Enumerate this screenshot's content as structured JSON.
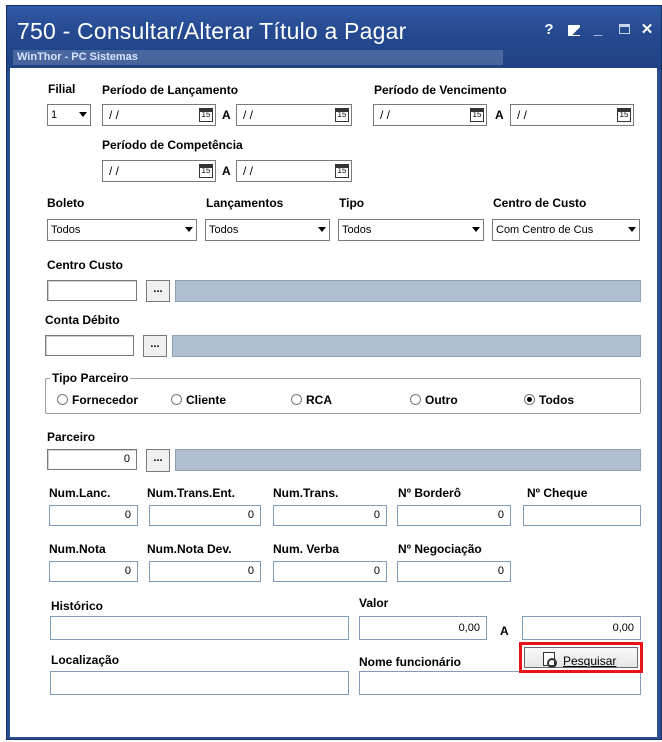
{
  "window": {
    "title": "750 - Consultar/Alterar Título a Pagar",
    "subtitle": "WinThor - PC Sistemas",
    "help": "?",
    "minimize": "_",
    "close": "✕"
  },
  "filial": {
    "label": "Filial",
    "value": "1"
  },
  "periodo_lancamento": {
    "label": "Período de Lançamento",
    "start": "/ /",
    "sep": "A",
    "end": "/ /",
    "cal": "15"
  },
  "periodo_vencimento": {
    "label": "Período de Vencimento",
    "start": "/ /",
    "sep": "A",
    "end": "/ /",
    "cal": "15"
  },
  "periodo_competencia": {
    "label": "Período de Competência",
    "start": "/ /",
    "sep": "A",
    "end": "/ /",
    "cal": "15"
  },
  "boleto": {
    "label": "Boleto",
    "value": "Todos"
  },
  "lancamentos": {
    "label": "Lançamentos",
    "value": "Todos"
  },
  "tipo": {
    "label": "Tipo",
    "value": "Todos"
  },
  "centro_custo_combo": {
    "label": "Centro de Custo",
    "value": "Com Centro de Cus"
  },
  "centro_custo": {
    "label": "Centro Custo",
    "dots": "..."
  },
  "conta_debito": {
    "label": "Conta Débito",
    "dots": "..."
  },
  "tipo_parceiro": {
    "label": "Tipo Parceiro",
    "options": [
      "Fornecedor",
      "Cliente",
      "RCA",
      "Outro",
      "Todos"
    ],
    "selected": "Todos"
  },
  "parceiro": {
    "label": "Parceiro",
    "value": "0",
    "dots": "..."
  },
  "row1": {
    "num_lanc": {
      "label": "Num.Lanc.",
      "value": "0"
    },
    "num_trans_ent": {
      "label": "Num.Trans.Ent.",
      "value": "0"
    },
    "num_trans": {
      "label": "Num.Trans.",
      "value": "0"
    },
    "num_bordero": {
      "label": "Nº Borderô",
      "value": "0"
    },
    "num_cheque": {
      "label": "Nº Cheque",
      "value": ""
    }
  },
  "row2": {
    "num_nota": {
      "label": "Num.Nota",
      "value": "0"
    },
    "num_nota_dev": {
      "label": "Num.Nota Dev.",
      "value": "0"
    },
    "num_verba": {
      "label": "Num. Verba",
      "value": "0"
    },
    "num_negociacao": {
      "label": "Nº Negociação",
      "value": "0"
    }
  },
  "historico": {
    "label": "Histórico",
    "value": ""
  },
  "valor": {
    "label": "Valor",
    "start": "0,00",
    "sep": "A",
    "end": "0,00"
  },
  "localizacao": {
    "label": "Localização",
    "value": ""
  },
  "nome_funcionario": {
    "label": "Nome funcionário",
    "value": ""
  },
  "pesquisar": {
    "label": "Pesquisar"
  }
}
